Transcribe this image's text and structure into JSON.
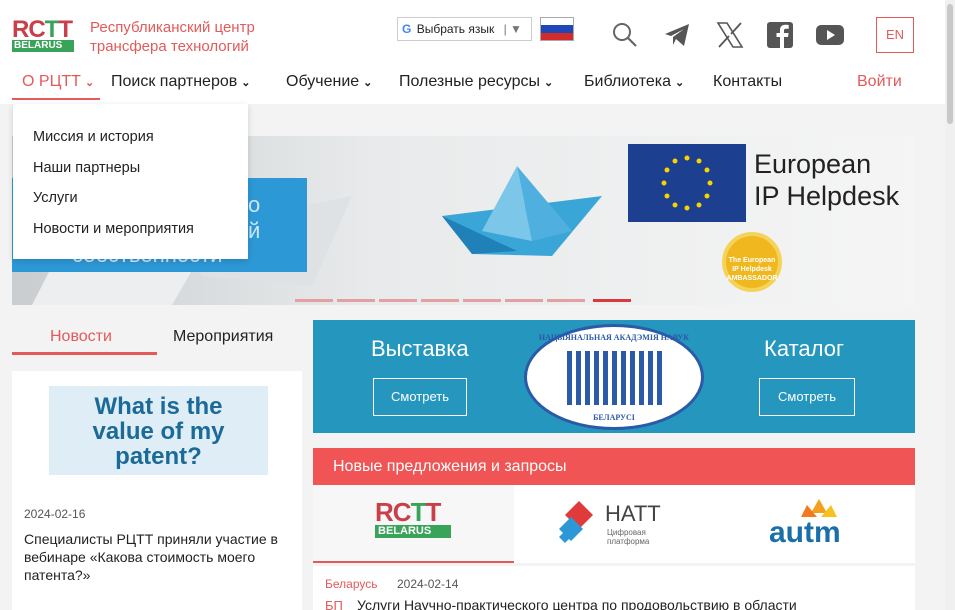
{
  "header": {
    "logo_text": "RCTT BELARUS",
    "org_name_line1": "Республиканский центр",
    "org_name_line2": "трансфера технологий",
    "translate_label": "Выбрать язык",
    "lang_button": "EN",
    "icons": [
      "search-icon",
      "telegram-icon",
      "x-icon",
      "facebook-icon",
      "youtube-icon"
    ]
  },
  "nav": {
    "items": [
      {
        "label": "О РЦТТ",
        "has_dropdown": true,
        "active": true
      },
      {
        "label": "Поиск партнеров",
        "has_dropdown": true
      },
      {
        "label": "Обучение",
        "has_dropdown": true
      },
      {
        "label": "Полезные ресурсы",
        "has_dropdown": true
      },
      {
        "label": "Библиотека",
        "has_dropdown": true
      },
      {
        "label": "Контакты",
        "has_dropdown": false
      }
    ],
    "login": "Войти",
    "dropdown": [
      "Миссия и история",
      "Наши партнеры",
      "Услуги",
      "Новости и мероприятия"
    ]
  },
  "banner": {
    "partial_text_1": "о",
    "partial_text_2": "й",
    "partial_text_3": "собственности",
    "eu_title_line1": "European",
    "eu_title_line2": "IP Helpdesk",
    "badge_text": "The European IP Helpdesk AMBASSADOR",
    "slide_count": 8,
    "active_slide": 8
  },
  "news": {
    "tabs": [
      "Новости",
      "Мероприятия"
    ],
    "image_text_line1": "What is the",
    "image_text_line2": "value of my",
    "image_text_line3": "patent?",
    "date": "2024-02-16",
    "title": "Специалисты РЦТТ приняли участие в вебинаре «Какова стоимость моего патента?»"
  },
  "expo": {
    "left_label": "Выставка",
    "right_label": "Каталог",
    "button_label": "Смотреть",
    "seal_top": "НАЦЫЯНАЛЬНАЯ АКАДЭМІЯ НАВУК",
    "seal_bottom": "БЕЛАРУСІ"
  },
  "offers": {
    "heading": "Новые предложения и запросы",
    "partners": [
      {
        "name": "RCTT BELARUS"
      },
      {
        "name": "НАТТ",
        "subtitle": "Цифровая платформа"
      },
      {
        "name": "autm"
      }
    ],
    "item": {
      "country": "Беларусь",
      "date": "2024-02-14",
      "tag": "БП",
      "title": "Услуги Научно-практического центра по продовольствию в области"
    }
  },
  "colors": {
    "accent": "#e35a5a",
    "expo_blue": "#2596be",
    "offers_red": "#f05454",
    "banner_blue": "#2d98d6"
  }
}
